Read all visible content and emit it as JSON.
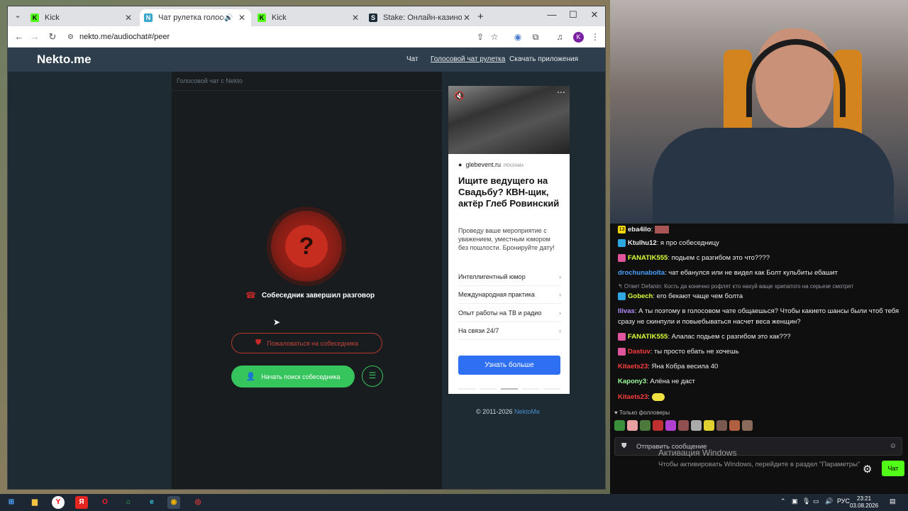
{
  "browser": {
    "tabs": [
      {
        "title": "Kick",
        "favicon": "K",
        "color": "#53fc18",
        "active": false
      },
      {
        "title": "Чат рулетка голосовая — ",
        "favicon": "N",
        "color": "#3aa6c9",
        "active": true
      },
      {
        "title": "Kick",
        "favicon": "K",
        "color": "#53fc18",
        "active": false
      },
      {
        "title": "Stake: Онлайн-казино и став",
        "favicon": "S",
        "color": "#1a2c38",
        "active": false
      }
    ],
    "new_tab": "+",
    "url": "nekto.me/audiochat#/peer",
    "profile_initial": "K"
  },
  "site": {
    "logo": "Nekto.me",
    "nav": [
      "Чат",
      "Голосовой чат рулетка",
      "Скачать приложения"
    ],
    "chat_header": "Голосовой чат с Nekto",
    "status_icon": "?",
    "ended_text": "Собеседник завершил разговор",
    "report_label": "Пожаловаться на собеседника",
    "search_label": "Начать поиск собеседника",
    "copyright_prefix": "© 2011-2026 ",
    "copyright_brand": "NektoMe"
  },
  "ad": {
    "source": "glebevent.ru",
    "source_tag": "РЕКЛАМА",
    "title": "Ищите ведущего на Свадьбу? КВН-щик, актёр Глеб Ровинский",
    "description": "Проведу ваше мероприятие с уважением, уместным юмором без пошлости. Бронируйте дату!",
    "items": [
      "Интеллигентный юмор",
      "Международная практика",
      "Опыт работы на ТВ и радио",
      "На связи 24/7"
    ],
    "cta": "Узнать больше"
  },
  "chat": {
    "messages": [
      {
        "badge": "13",
        "badge_color": "#f5d60a",
        "user": "eba4ilo",
        "user_color": "#ffffff",
        "text": ""
      },
      {
        "badge": "",
        "badge_color": "#2fa7e0",
        "user": "Ktulhu12",
        "user_color": "#ffffff",
        "text": "я про собеседницу"
      },
      {
        "badge": "",
        "badge_color": "#e0559b",
        "user": "FANATIK555",
        "user_color": "#d8ff3a",
        "text": "подьем с разгибом это что????"
      },
      {
        "badge": "",
        "badge_color": "",
        "user": "drochunabolta",
        "user_color": "#4aa0ff",
        "text": "чат ебанулся или не видел как Болт кульбиты ебашит"
      },
      {
        "badge": "",
        "badge_color": "#2fa7e0",
        "user": "Gobech",
        "user_color": "#d8ff3a",
        "text": "его бекают чаще чем болта"
      },
      {
        "badge": "",
        "badge_color": "",
        "user": "Ilivas",
        "user_color": "#b38cff",
        "text": "А ты поэтому в голосовом чате общаешься? Чтобы какието шансы были чтоб тебя сразу не скинпули и повыебываться насчет веса женщин?"
      },
      {
        "badge": "",
        "badge_color": "#e0559b",
        "user": "FANATIK555",
        "user_color": "#d8ff3a",
        "text": "Алалас подьем с разгибом это как???"
      },
      {
        "badge": "",
        "badge_color": "#e0559b",
        "user": "Dastuv",
        "user_color": "#ff3d3d",
        "text": "ты просто ебать не хочешь"
      },
      {
        "badge": "",
        "badge_color": "",
        "user": "Kitaets23",
        "user_color": "#ff3d3d",
        "text": "Яна Кобра весила 40"
      },
      {
        "badge": "",
        "badge_color": "",
        "user": "Kapony3",
        "user_color": "#9dff9d",
        "text": "Алёна не даст"
      },
      {
        "badge": "",
        "badge_color": "",
        "user": "Kitaets23",
        "user_color": "#ff3d3d",
        "text": ""
      }
    ],
    "reply_note": "↰ Ответ Defanin: Кость да конечно рофлят кто нахуй ваще хрипатого на серьезе смотрят",
    "followers_only": "♥ Только фолловеры",
    "input_placeholder": "Отправить сообщение",
    "send_label": "Чат"
  },
  "windows": {
    "activate_title": "Активация Windows",
    "activate_sub": "Чтобы активировать Windows, перейдите в раздел \"Параметры\"",
    "lang": "РУС",
    "time": "23:21",
    "date": "03.08.2026"
  }
}
